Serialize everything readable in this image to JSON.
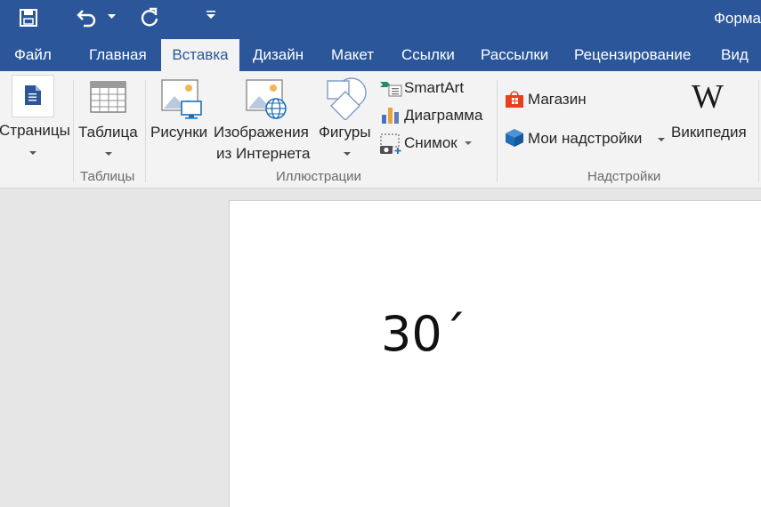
{
  "title_bar": {
    "title_partial": "Форма",
    "qat": {
      "save_icon": "save-icon",
      "undo_icon": "undo-icon",
      "redo_icon": "redo-icon",
      "customize_icon": "customize-qat-icon"
    }
  },
  "tabs": [
    {
      "label": "Файл",
      "active": false
    },
    {
      "label": "Главная",
      "active": false
    },
    {
      "label": "Вставка",
      "active": true
    },
    {
      "label": "Дизайн",
      "active": false
    },
    {
      "label": "Макет",
      "active": false
    },
    {
      "label": "Ссылки",
      "active": false
    },
    {
      "label": "Рассылки",
      "active": false
    },
    {
      "label": "Рецензирование",
      "active": false
    },
    {
      "label": "Вид",
      "active": false
    }
  ],
  "ribbon": {
    "pages": {
      "label": "Страницы",
      "icon": "pages-icon"
    },
    "tables_group": {
      "label": "Таблицы",
      "table": {
        "label": "Таблица",
        "icon": "table-icon"
      }
    },
    "illustrations_group": {
      "label": "Иллюстрации",
      "pictures": {
        "label": "Рисунки",
        "icon": "pictures-icon"
      },
      "online_pictures": {
        "label_line1": "Изображения",
        "label_line2": "из Интернета",
        "icon": "online-pictures-icon"
      },
      "shapes": {
        "label": "Фигуры",
        "icon": "shapes-icon"
      },
      "smartart": {
        "label": "SmartArt",
        "icon": "smartart-icon"
      },
      "chart": {
        "label": "Диаграмма",
        "icon": "chart-icon"
      },
      "screenshot": {
        "label": "Снимок",
        "icon": "screenshot-icon"
      }
    },
    "addins_group": {
      "label": "Надстройки",
      "store": {
        "label": "Магазин",
        "icon": "store-icon"
      },
      "my_addins": {
        "label": "Мои надстройки",
        "icon": "my-addins-icon"
      },
      "wikipedia": {
        "label": "Википедия",
        "glyph": "W",
        "icon": "wikipedia-icon"
      }
    }
  },
  "document": {
    "text": "30´"
  },
  "colors": {
    "title_bar": "#2b579a",
    "ribbon_bg": "#f3f3f3",
    "doc_bg": "#e6e6e6",
    "page_bg": "#ffffff",
    "store_orange": "#e8401c",
    "addins_blue": "#1e6fb8"
  }
}
